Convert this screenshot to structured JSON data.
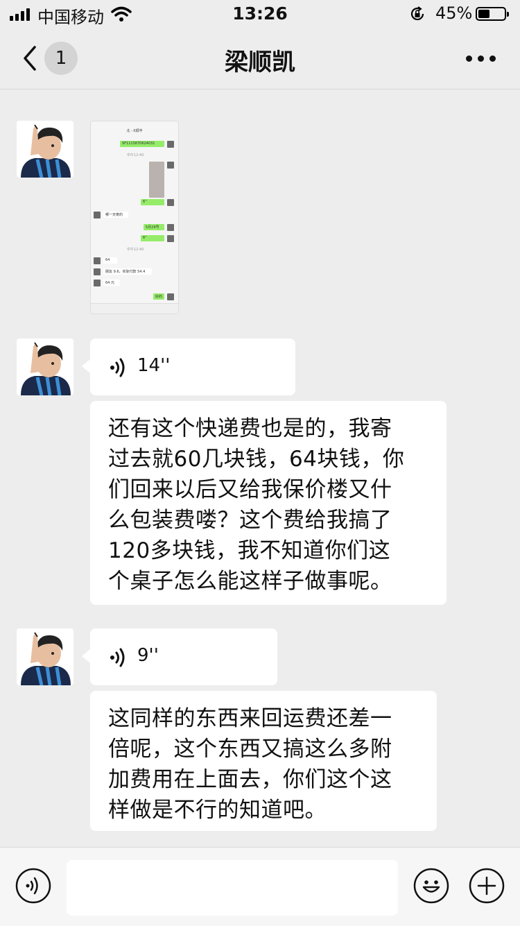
{
  "status_bar": {
    "carrier": "中国移动",
    "time": "13:26",
    "battery_percent": "45%",
    "battery_level": 0.45,
    "icons": [
      "signal-icon",
      "wifi-icon",
      "orientation-lock-icon",
      "battery-icon"
    ]
  },
  "nav": {
    "unread_count": "1",
    "title": "梁顺凯",
    "icons": [
      "back-chevron-icon",
      "more-icon"
    ]
  },
  "messages": [
    {
      "type": "image",
      "sender": "contact",
      "image_content": {
        "title": "北 - K顺丰",
        "rows": [
          {
            "side": "right",
            "text": "SF1115870624031"
          },
          {
            "side": "center",
            "text": "中午12:40"
          },
          {
            "side": "right",
            "text": ""
          },
          {
            "side": "right",
            "text": "6''"
          },
          {
            "side": "left",
            "text": "哪一天寄的"
          },
          {
            "side": "right",
            "text": "5月29号"
          },
          {
            "side": "right",
            "text": "6''"
          },
          {
            "side": "center",
            "text": "中午12:40"
          },
          {
            "side": "left",
            "text": "64"
          },
          {
            "side": "left",
            "text": "朋友 9.6，实际付款 54.4"
          },
          {
            "side": "left",
            "text": "64 元"
          },
          {
            "side": "right",
            "text": "好的"
          }
        ]
      }
    },
    {
      "type": "voice",
      "sender": "contact",
      "duration": "14''"
    },
    {
      "type": "text",
      "sender": "contact",
      "lines": [
        "还有这个快递费也是的，我寄",
        "过去就60几块钱，64块钱，你",
        "们回来以后又给我保价楼又什",
        "么包装费喽？这个费给我搞了",
        "120多块钱，我不知道你们这",
        "个桌子怎么能这样子做事呢。"
      ]
    },
    {
      "type": "voice",
      "sender": "contact",
      "duration": "9''"
    },
    {
      "type": "text",
      "sender": "contact",
      "lines": [
        "这同样的东西来回运费还差一",
        "倍呢，这个东西又搞这么多附",
        "加费用在上面去，你们这个这",
        "样做是不行的知道吧。"
      ]
    }
  ],
  "input_bar": {
    "value": "",
    "placeholder": "",
    "icons": [
      "voice-input-icon",
      "emoji-icon",
      "plus-icon"
    ]
  },
  "colors": {
    "background": "#ededed",
    "bubble_other": "#ffffff",
    "bubble_self": "#95ec69",
    "input_bar": "#f6f6f6"
  }
}
